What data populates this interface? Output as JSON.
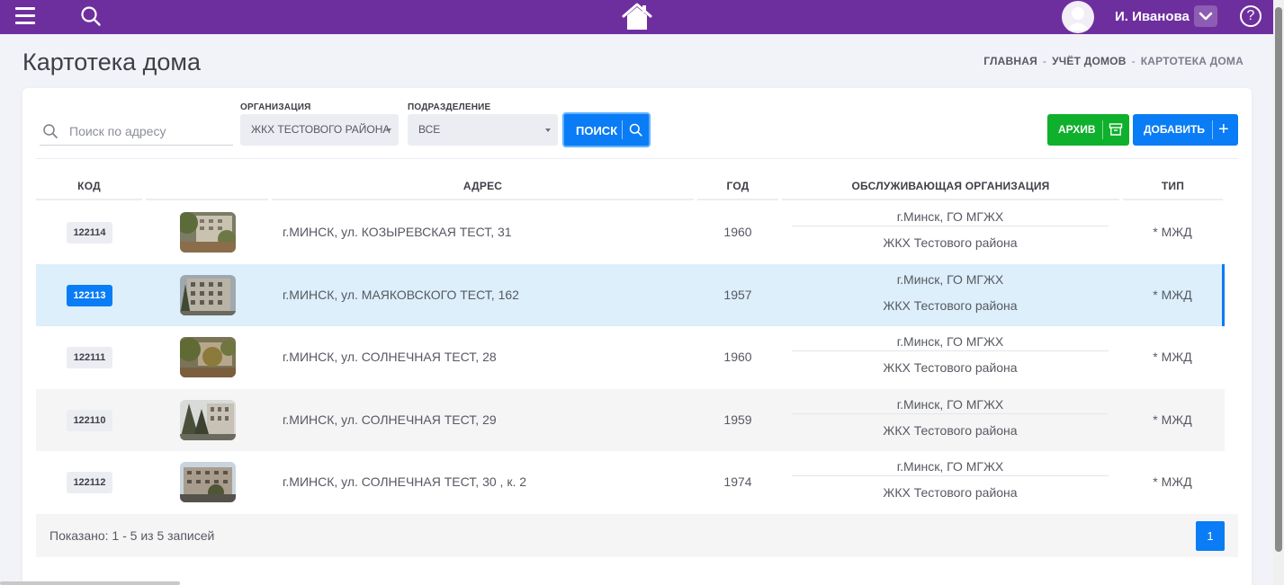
{
  "topbar": {
    "menu_icon": "hamburger-icon",
    "search_icon": "search-icon",
    "home_icon": "home-icon",
    "user_name": "И. Иванова",
    "user_toggle_icon": "chevron-down-icon",
    "help_label": "?",
    "colors": {
      "bar": "#6e2f9e"
    }
  },
  "header": {
    "title": "Картотека дома",
    "breadcrumbs": [
      "ГЛАВНАЯ",
      "УЧЁТ ДОМОВ",
      "КАРТОТЕКА ДОМА"
    ],
    "separator": "-"
  },
  "filters": {
    "search_placeholder": "Поиск по адресу",
    "search_value": "",
    "organization_label": "ОРГАНИЗАЦИЯ",
    "organization_value": "ЖКХ ТЕСТОВОГО РАЙОНА",
    "subdivision_label": "ПОДРАЗДЕЛЕНИЕ",
    "subdivision_value": "ВСЕ",
    "search_button": "ПОИСК",
    "archive_button": "АРХИВ",
    "add_button": "ДОБАВИТЬ",
    "add_icon": "+"
  },
  "table": {
    "columns": [
      "КОД",
      "",
      "АДРЕС",
      "ГОД",
      "ОБСЛУЖИВАЮЩАЯ ОРГАНИЗАЦИЯ",
      "ТИП"
    ],
    "rows": [
      {
        "code": "122114",
        "address": "г.МИНСК, ул. КОЗЫРЕВСКАЯ ТЕСТ, 31",
        "year": "1960",
        "org1": "г.Минск, ГО МГЖХ",
        "org2": "ЖКХ Тестового района",
        "type": "* МЖД",
        "selected": false
      },
      {
        "code": "122113",
        "address": "г.МИНСК, ул. МАЯКОВСКОГО ТЕСТ, 162",
        "year": "1957",
        "org1": "г.Минск, ГО МГЖХ",
        "org2": "ЖКХ Тестового района",
        "type": "* МЖД",
        "selected": true
      },
      {
        "code": "122111",
        "address": "г.МИНСК, ул. СОЛНЕЧНАЯ ТЕСТ, 28",
        "year": "1960",
        "org1": "г.Минск, ГО МГЖХ",
        "org2": "ЖКХ Тестового района",
        "type": "* МЖД",
        "selected": false
      },
      {
        "code": "122110",
        "address": "г.МИНСК, ул. СОЛНЕЧНАЯ ТЕСТ, 29",
        "year": "1959",
        "org1": "г.Минск, ГО МГЖХ",
        "org2": "ЖКХ Тестового района",
        "type": "* МЖД",
        "selected": false
      },
      {
        "code": "122112",
        "address": "г.МИНСК, ул. СОЛНЕЧНАЯ ТЕСТ, 30 , к. 2",
        "year": "1974",
        "org1": "г.Минск, ГО МГЖХ",
        "org2": "ЖКХ Тестового района",
        "type": "* МЖД",
        "selected": false
      }
    ]
  },
  "footer": {
    "info": "Показано: 1 - 5 из 5 записей",
    "current_page": "1"
  },
  "colors": {
    "primary": "#0a7cf5",
    "success": "#0fb02b",
    "selected_row": "#dceffa"
  }
}
